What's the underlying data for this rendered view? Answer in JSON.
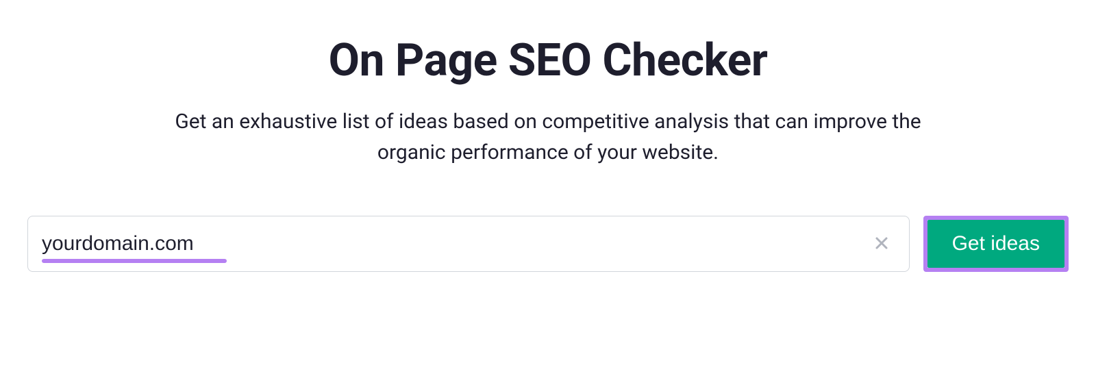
{
  "header": {
    "title": "On Page SEO Checker",
    "subtitle": "Get an exhaustive list of ideas based on competitive analysis that can improve the organic performance of your website."
  },
  "form": {
    "domain_value": "yourdomain.com",
    "submit_label": "Get ideas"
  },
  "highlights": {
    "input_underline_color": "#b580f2",
    "button_outline_color": "#b580f2"
  }
}
